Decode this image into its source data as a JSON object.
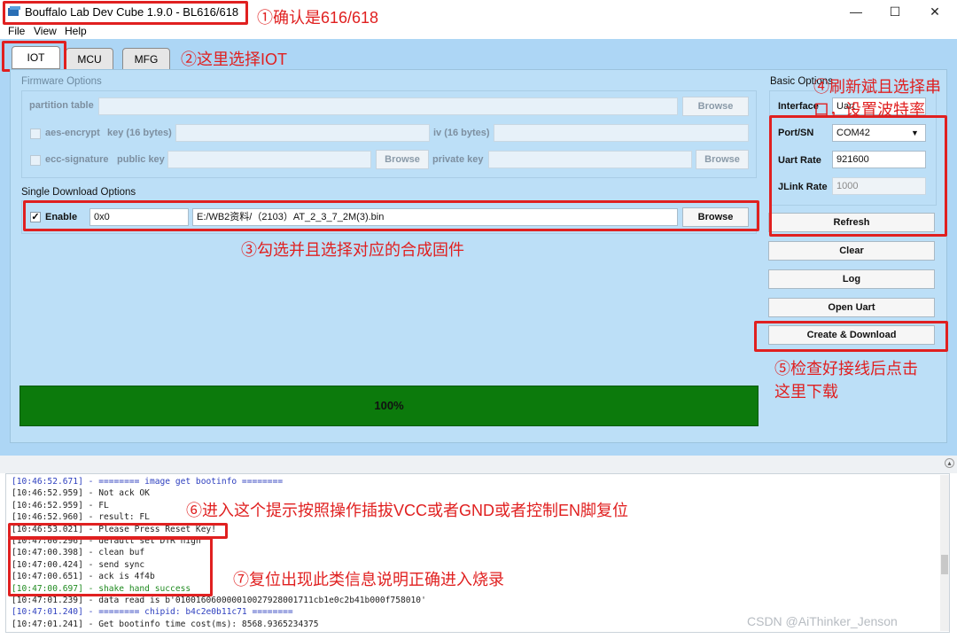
{
  "window": {
    "title": "Bouffalo Lab Dev Cube 1.9.0 - BL616/618",
    "minimize": "—",
    "maximize": "☐",
    "close": "✕"
  },
  "menu": [
    "File",
    "View",
    "Help"
  ],
  "tabs": [
    "IOT",
    "MCU",
    "MFG"
  ],
  "firmware": {
    "group_label": "Firmware Options",
    "partition_table": "partition table",
    "aes_encrypt": "aes-encrypt",
    "key_label": "key (16 bytes)",
    "iv_label": "iv (16 bytes)",
    "ecc_signature": "ecc-signature",
    "public_key": "public key",
    "private_key": "private key",
    "browse": "Browse"
  },
  "single": {
    "group_label": "Single Download Options",
    "enable": "Enable",
    "address": "0x0",
    "path": "E:/WB2资料/（2103）AT_2_3_7_2M(3).bin",
    "browse": "Browse",
    "check": "✓"
  },
  "basic": {
    "group_label": "Basic Options",
    "interface": "Interface",
    "interface_value": "Uart",
    "port_label": "Port/SN",
    "port_value": "COM42",
    "uart_label": "Uart Rate",
    "uart_value": "921600",
    "jlink_label": "JLink Rate",
    "jlink_value": "1000",
    "refresh": "Refresh",
    "clear": "Clear",
    "log": "Log",
    "open_uart": "Open Uart",
    "create_download": "Create & Download"
  },
  "progress": {
    "value": 100,
    "label": "100%"
  },
  "annotations": {
    "a1": "①确认是616/618",
    "a2": "②这里选择IOT",
    "a3": "③勾选并且选择对应的合成固件",
    "a4_line1": "④刷新斌且选择串",
    "a4_line2": "口，设置波特率",
    "a5_line1": "⑤检查好接线后点击",
    "a5_line2": "这里下载",
    "a6": "⑥进入这个提示按照操作插拔VCC或者GND或者控制EN脚复位",
    "a7": "⑦复位出现此类信息说明正确进入烧录"
  },
  "log_lines": [
    {
      "text": "[10:46:52.671] - ======== image get bootinfo ========",
      "color": "blue"
    },
    {
      "text": "[10:46:52.959] - Not ack OK",
      "color": "normal"
    },
    {
      "text": "[10:46:52.959] - FL",
      "color": "normal"
    },
    {
      "text": "[10:46:52.960] - result: FL",
      "color": "normal"
    },
    {
      "text": "[10:46:53.021] - Please Press Reset Key!",
      "color": "normal"
    },
    {
      "text": "[10:47:00.296] - default set DTR high",
      "color": "normal"
    },
    {
      "text": "[10:47:00.398] - clean buf",
      "color": "normal"
    },
    {
      "text": "[10:47:00.424] - send sync",
      "color": "normal"
    },
    {
      "text": "[10:47:00.651] - ack is 4f4b",
      "color": "normal"
    },
    {
      "text": "[10:47:00.697] - shake hand success",
      "color": "green"
    },
    {
      "text": "[10:47:01.239] - data read is b'010016060000010027928001711cb1e0c2b41b000f758010'",
      "color": "normal"
    },
    {
      "text": "[10:47:01.240] - ======== chipid: b4c2e0b11c71 ========",
      "color": "blue"
    },
    {
      "text": "[10:47:01.241] - Get bootinfo time cost(ms): 8568.9365234375",
      "color": "normal"
    }
  ],
  "watermark": "CSDN @AiThinker_Jenson"
}
